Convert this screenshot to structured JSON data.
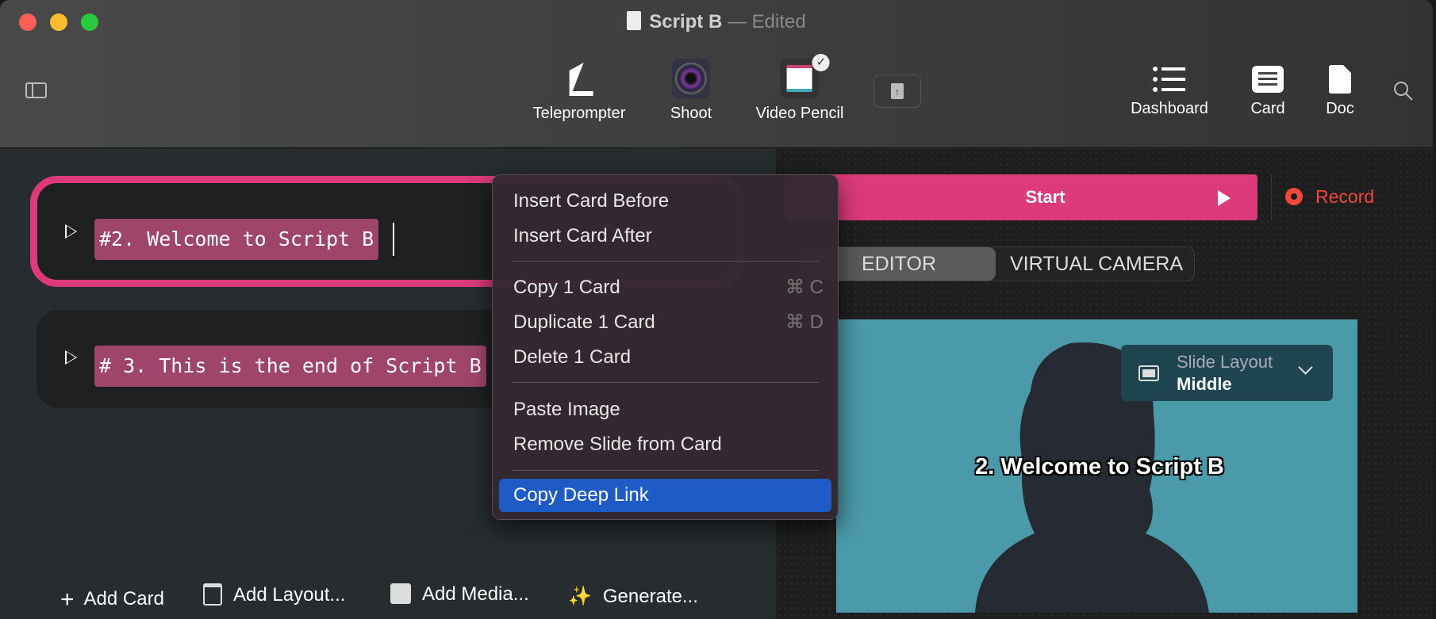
{
  "window": {
    "title": "Script B",
    "title_sep": "—",
    "status": "Edited"
  },
  "toolbar": {
    "tools": [
      {
        "label": "Teleprompter",
        "icon": "teleprompter-icon"
      },
      {
        "label": "Shoot",
        "icon": "camera-lens-icon"
      },
      {
        "label": "Video Pencil",
        "icon": "video-pencil-icon"
      }
    ],
    "views": [
      {
        "label": "Dashboard",
        "icon": "list-icon"
      },
      {
        "label": "Card",
        "icon": "card-icon"
      },
      {
        "label": "Doc",
        "icon": "doc-icon"
      }
    ]
  },
  "cards": [
    {
      "text": "#2. Welcome to Script B"
    },
    {
      "text": "# 3. This is the end of Script B"
    }
  ],
  "bottom_bar": {
    "add_card": "Add Card",
    "add_layout": "Add Layout...",
    "add_media": "Add Media...",
    "generate": "Generate..."
  },
  "context_menu": {
    "items": [
      {
        "label": "Insert Card Before"
      },
      {
        "label": "Insert Card After"
      },
      {
        "label": "Copy 1 Card",
        "shortcut": "⌘ C"
      },
      {
        "label": "Duplicate 1 Card",
        "shortcut": "⌘ D"
      },
      {
        "label": "Delete 1 Card"
      },
      {
        "label": "Paste Image"
      },
      {
        "label": "Remove Slide from Card"
      },
      {
        "label": "Copy Deep Link"
      }
    ]
  },
  "controls": {
    "start": "Start",
    "record": "Record",
    "tabs": [
      "EDITOR",
      "VIRTUAL CAMERA"
    ],
    "active_tab": "EDITOR"
  },
  "preview": {
    "slide_layout_label": "Slide Layout",
    "slide_layout_value": "Middle",
    "caption": "2. Welcome to Script B"
  },
  "colors": {
    "accent": "#dc3a7a",
    "record": "#f0493b",
    "menu_highlight": "#1e5bc6",
    "preview_bg": "#4a9aa9"
  }
}
